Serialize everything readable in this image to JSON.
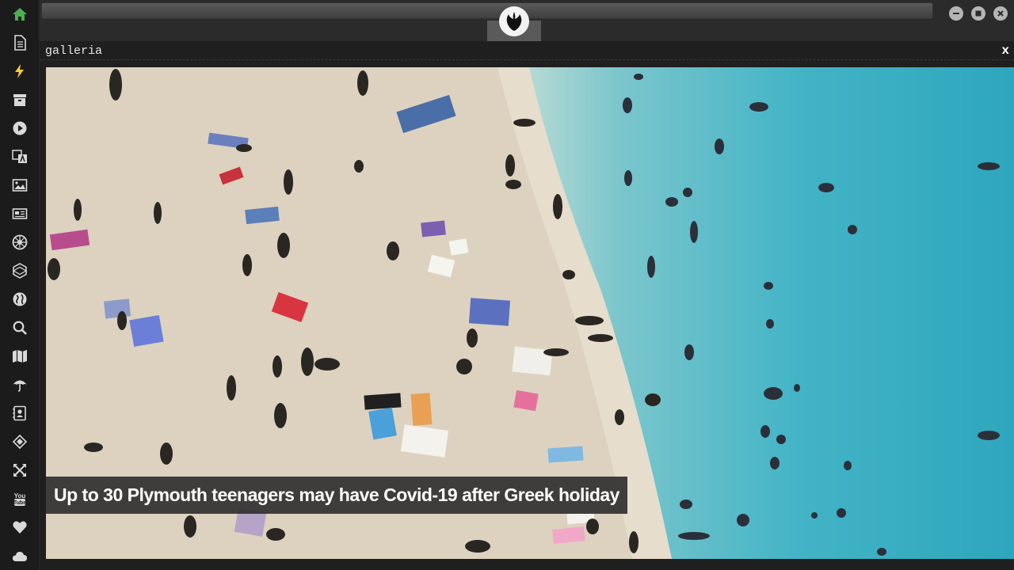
{
  "sidebar": {
    "items": [
      {
        "icon": "home-icon",
        "name": "home"
      },
      {
        "icon": "document-icon",
        "name": "document"
      },
      {
        "icon": "lightning-icon",
        "name": "lightning"
      },
      {
        "icon": "archive-icon",
        "name": "archive"
      },
      {
        "icon": "play-icon",
        "name": "play"
      },
      {
        "icon": "translate-icon",
        "name": "translate"
      },
      {
        "icon": "image-icon",
        "name": "image"
      },
      {
        "icon": "newspaper-icon",
        "name": "newspaper"
      },
      {
        "icon": "empire-icon",
        "name": "empire"
      },
      {
        "icon": "hexagon-icon",
        "name": "hexagon"
      },
      {
        "icon": "globe-icon",
        "name": "globe"
      },
      {
        "icon": "search-icon",
        "name": "search"
      },
      {
        "icon": "map-icon",
        "name": "map"
      },
      {
        "icon": "umbrella-icon",
        "name": "umbrella"
      },
      {
        "icon": "contact-icon",
        "name": "contact"
      },
      {
        "icon": "code-icon",
        "name": "code"
      },
      {
        "icon": "expand-icon",
        "name": "expand"
      },
      {
        "icon": "youtube-icon",
        "name": "youtube"
      },
      {
        "icon": "heart-icon",
        "name": "heart"
      },
      {
        "icon": "cloud-icon",
        "name": "cloud"
      }
    ],
    "home_color": "#4caf50",
    "active_color": "#ffcc33",
    "icon_color": "#d9d9d9"
  },
  "topbar": {
    "brand_icon": "rebel-alliance-icon",
    "window_controls": [
      "minimize-icon",
      "maximize-icon",
      "close-icon"
    ]
  },
  "panel": {
    "title": "galleria",
    "close_label": "x"
  },
  "gallery": {
    "caption": "Up to 30 Plymouth teenagers may have Covid-19 after Greek holiday",
    "sand_color": "#ddd2c0",
    "water_color": "#3fb2c4"
  }
}
